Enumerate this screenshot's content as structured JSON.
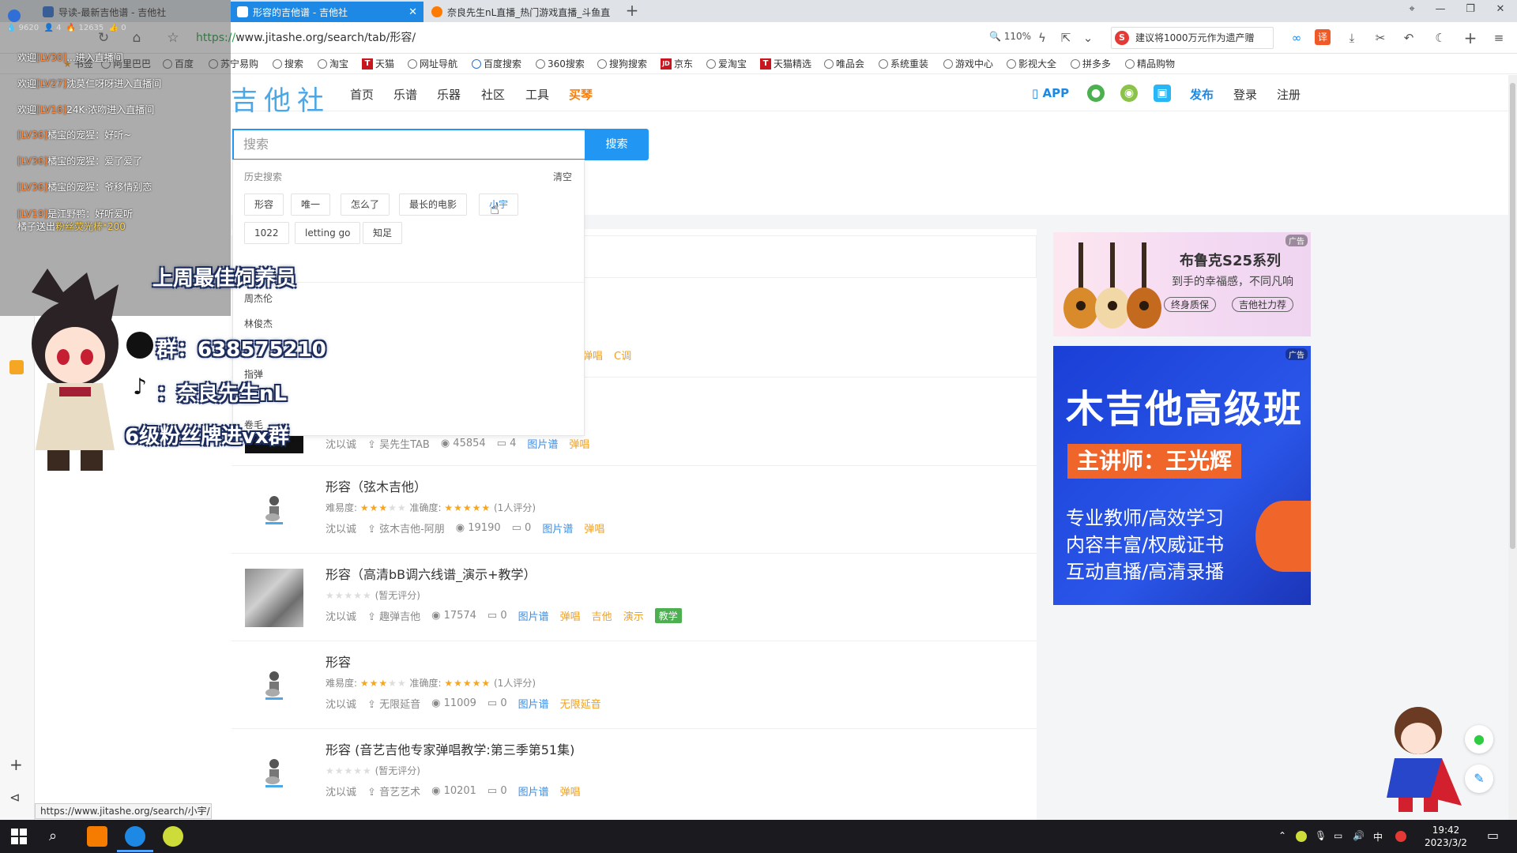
{
  "tabs": [
    {
      "label": "导读-最新吉他谱 - 吉他社",
      "active": false
    },
    {
      "label": "形容的吉他谱 - 吉他社",
      "active": true
    },
    {
      "label": "奈良先生nL直播_热门游戏直播_斗鱼直",
      "active": false
    }
  ],
  "address": {
    "scheme": "https://",
    "rest": "www.jitashe.org/search/tab/形容/",
    "zoom": "110%",
    "sogou_search": "建议将1000万元作为遗产赠"
  },
  "bookmarks": [
    "书签",
    "阿里巴巴",
    "百度",
    "苏宁易购",
    "搜索",
    "淘宝",
    "天猫",
    "网址导航",
    "百度搜索",
    "360搜索",
    "搜狗搜索",
    "京东",
    "爱淘宝",
    "天猫精选",
    "唯品会",
    "系统重装",
    "游戏中心",
    "影视大全",
    "拼多多",
    "精品购物"
  ],
  "site": {
    "logo": "吉他社",
    "nav": [
      "首页",
      "乐谱",
      "乐器",
      "社区",
      "工具",
      "买琴"
    ],
    "header_right": {
      "app": "APP",
      "publish": "发布",
      "login": "登录",
      "register": "注册"
    }
  },
  "search": {
    "placeholder": "搜索",
    "button": "搜索",
    "history_label": "历史搜索",
    "clear": "清空",
    "history": [
      "形容",
      "唯一",
      "怎么了",
      "最长的电影",
      "小宇",
      "1022",
      "letting go",
      "知足"
    ],
    "suggestions": [
      "周杰伦",
      "林俊杰",
      "指弹",
      "卷毛"
    ]
  },
  "results": [
    {
      "title": "",
      "rating_label": "",
      "author": "",
      "uploader": "",
      "views": "",
      "comments": "",
      "tags": [
        "弹唱",
        "C调"
      ],
      "thumb": "none"
    },
    {
      "title": "",
      "rating_label": "",
      "author": "沈以诚",
      "uploader": "吴先生TAB",
      "views": "45854",
      "comments": "4",
      "tags": [
        "图片谱",
        "弹唱"
      ],
      "thumb": "dark"
    },
    {
      "title": "形容（弦木吉他）",
      "difficulty_label": "难易度:",
      "difficulty": 3,
      "accuracy_label": "准确度:",
      "accuracy": 5,
      "rating_label": "(1人评分)",
      "author": "沈以诚",
      "uploader": "弦木吉他-阿朋",
      "views": "19190",
      "comments": "0",
      "tags": [
        "图片谱",
        "弹唱"
      ],
      "thumb": "guitarist"
    },
    {
      "title": "形容（高清bB调六线谱_演示+教学）",
      "rating_label": "(暂无评分)",
      "author": "沈以诚",
      "uploader": "趣弹吉他",
      "views": "17574",
      "comments": "0",
      "tags": [
        "图片谱",
        "弹唱",
        "吉他",
        "演示"
      ],
      "green_tag": "教学",
      "thumb": "photo"
    },
    {
      "title": "形容",
      "difficulty_label": "难易度:",
      "difficulty": 3,
      "accuracy_label": "准确度:",
      "accuracy": 5,
      "rating_label": "(1人评分)",
      "author": "沈以诚",
      "uploader": "无限延音",
      "views": "11009",
      "comments": "0",
      "tags": [
        "图片谱",
        "无限延音"
      ],
      "thumb": "guitarist"
    },
    {
      "title": "形容 (音艺吉他专家弹唱教学:第三季第51集)",
      "rating_label": "(暂无评分)",
      "author": "沈以诚",
      "uploader": "音艺艺术",
      "views": "10201",
      "comments": "0",
      "tags": [
        "图片谱",
        "弹唱"
      ],
      "thumb": "guitarist"
    }
  ],
  "ads": {
    "badge": "广告",
    "ad1_title": "布鲁克S25系列",
    "ad1_sub": "到手的幸福感，不同凡响",
    "ad1_pill1": "终身质保",
    "ad1_pill2": "吉他社力荐",
    "ad2_title": "木吉他高级班",
    "ad2_teacher": "主讲师：王光辉",
    "ad2_line1": "专业教师/高效学习",
    "ad2_line2": "内容丰富/权威证书",
    "ad2_line3": "互动直播/高清录播"
  },
  "chat": {
    "lines": [
      {
        "pre": "欢迎",
        "lv": "[LV30]",
        "name": "...",
        "msg": "进入直播间"
      },
      {
        "pre": "欢迎",
        "lv": "[LV27]",
        "name": "沈莫仁呀呀",
        "msg": "进入直播间"
      },
      {
        "pre": "欢迎",
        "lv": "[LV16]",
        "name": "24K·浓吻",
        "msg": "进入直播间"
      },
      {
        "pre": "",
        "lv": "[LV36]",
        "name": "橘宝的宠猩：",
        "msg": "好听~"
      },
      {
        "pre": "",
        "lv": "[LV36]",
        "name": "橘宝的宠猩：",
        "msg": "爱了爱了"
      },
      {
        "pre": "",
        "lv": "[LV36]",
        "name": "橘宝的宠猩：",
        "msg": "爷移情别恋"
      },
      {
        "pre": "",
        "lv": "[LV19]",
        "name": "是江野鸭：",
        "msg": "好听爱听"
      },
      {
        "pre": "",
        "lv": "",
        "name": "橘子送出",
        "msg": "粉丝荧光棒*200"
      }
    ],
    "stats": [
      "9620",
      "4",
      "12635",
      "0"
    ]
  },
  "overlay": {
    "weekly": "上周最佳饲养员",
    "group": "群：638575210",
    "douyin": "：奈良先生nL",
    "fans": "6级粉丝牌进vx群"
  },
  "status_url": "https://www.jitashe.org/search/小宇/",
  "clock": {
    "time": "19:42",
    "date": "2023/3/2"
  },
  "tray": {
    "ime": "中"
  }
}
